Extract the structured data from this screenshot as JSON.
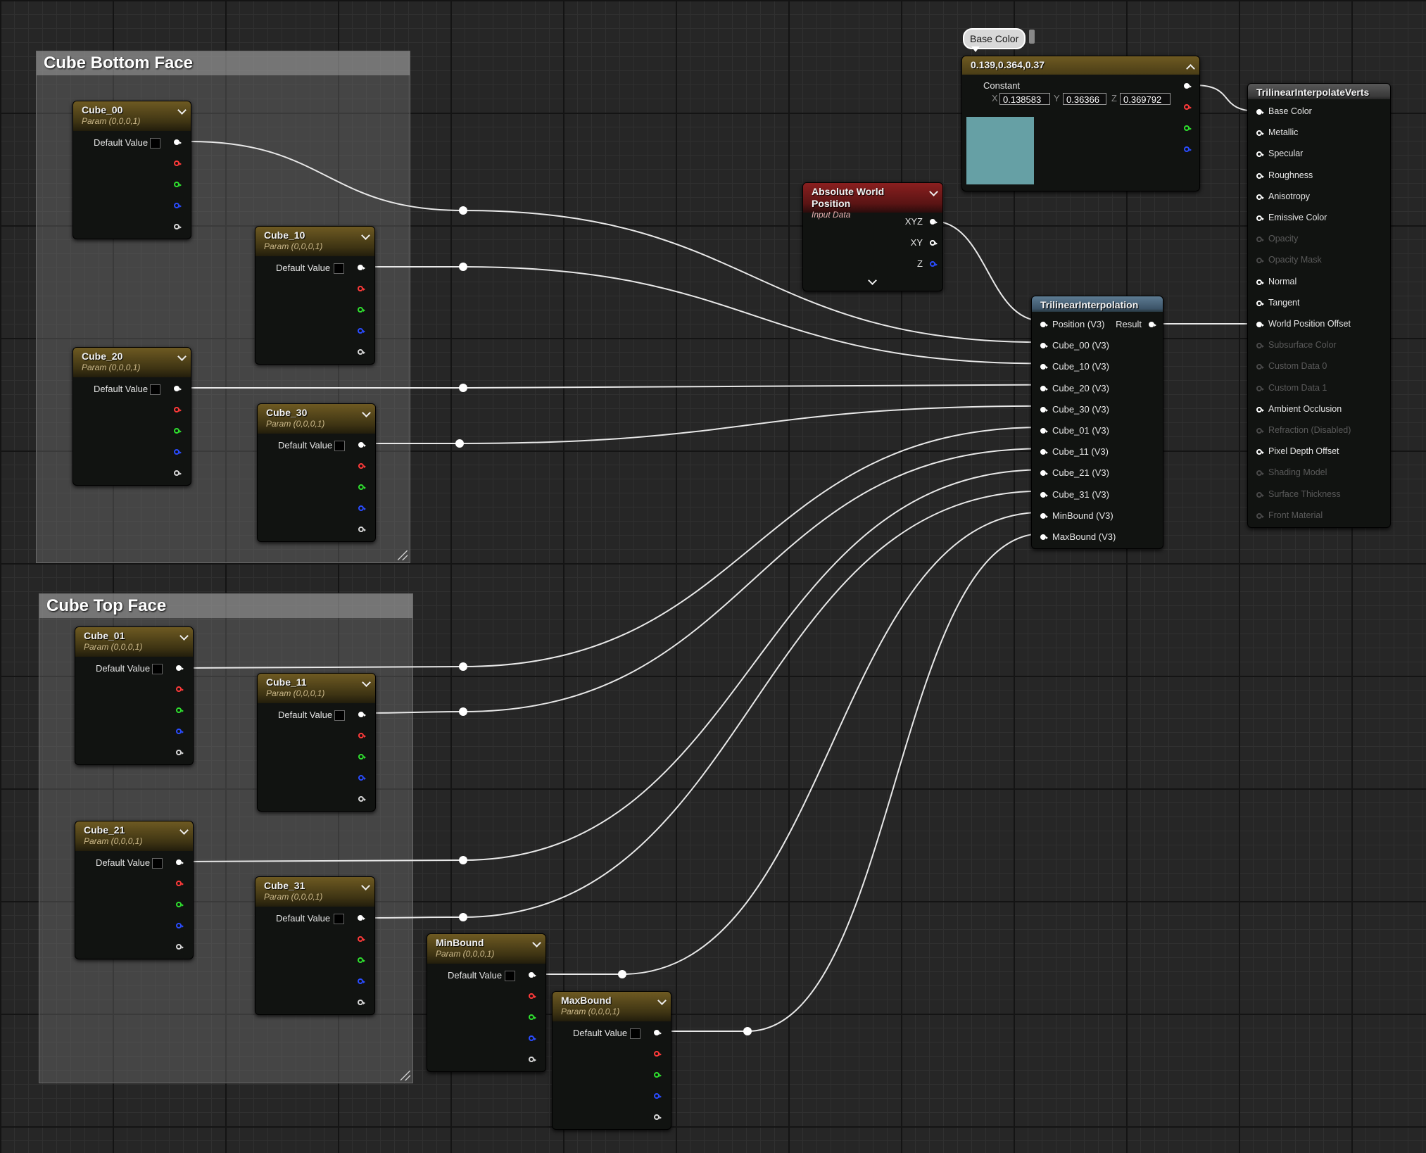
{
  "comments": {
    "bottom": "Cube Bottom Face",
    "top": "Cube Top Face"
  },
  "params": {
    "subtitle": "Param (0,0,0,1)",
    "default_label": "Default Value",
    "cube_00": "Cube_00",
    "cube_10": "Cube_10",
    "cube_20": "Cube_20",
    "cube_30": "Cube_30",
    "cube_01": "Cube_01",
    "cube_11": "Cube_11",
    "cube_21": "Cube_21",
    "cube_31": "Cube_31",
    "min_bound": "MinBound",
    "max_bound": "MaxBound"
  },
  "abs_world": {
    "title": "Absolute World Position",
    "subtitle": "Input Data",
    "outputs": [
      "XYZ",
      "XY",
      "Z"
    ]
  },
  "constant": {
    "bubble": "Base Color",
    "title": "0.139,0.364,0.37",
    "label": "Constant",
    "x_label": "X",
    "y_label": "Y",
    "z_label": "Z",
    "x": "0.138583",
    "y": "0.36366",
    "z": "0.369792",
    "swatch_color": "#66a0a5"
  },
  "trilinear": {
    "title": "TrilinearInterpolation",
    "inputs": [
      "Position (V3)",
      "Cube_00 (V3)",
      "Cube_10 (V3)",
      "Cube_20 (V3)",
      "Cube_30 (V3)",
      "Cube_01 (V3)",
      "Cube_11 (V3)",
      "Cube_21 (V3)",
      "Cube_31 (V3)",
      "MinBound (V3)",
      "MaxBound (V3)"
    ],
    "output": "Result"
  },
  "material": {
    "title": "TrilinearInterpolateVerts",
    "pins": [
      {
        "label": "Base Color",
        "state": "connected"
      },
      {
        "label": "Metallic",
        "state": "enabled"
      },
      {
        "label": "Specular",
        "state": "enabled"
      },
      {
        "label": "Roughness",
        "state": "enabled"
      },
      {
        "label": "Anisotropy",
        "state": "enabled"
      },
      {
        "label": "Emissive Color",
        "state": "enabled"
      },
      {
        "label": "Opacity",
        "state": "disabled"
      },
      {
        "label": "Opacity Mask",
        "state": "disabled"
      },
      {
        "label": "Normal",
        "state": "enabled"
      },
      {
        "label": "Tangent",
        "state": "enabled"
      },
      {
        "label": "World Position Offset",
        "state": "connected"
      },
      {
        "label": "Subsurface Color",
        "state": "disabled"
      },
      {
        "label": "Custom Data 0",
        "state": "disabled"
      },
      {
        "label": "Custom Data 1",
        "state": "disabled"
      },
      {
        "label": "Ambient Occlusion",
        "state": "enabled"
      },
      {
        "label": "Refraction (Disabled)",
        "state": "disabled"
      },
      {
        "label": "Pixel Depth Offset",
        "state": "enabled"
      },
      {
        "label": "Shading Model",
        "state": "disabled"
      },
      {
        "label": "Surface Thickness",
        "state": "disabled"
      },
      {
        "label": "Front Material",
        "state": "disabled"
      }
    ]
  }
}
